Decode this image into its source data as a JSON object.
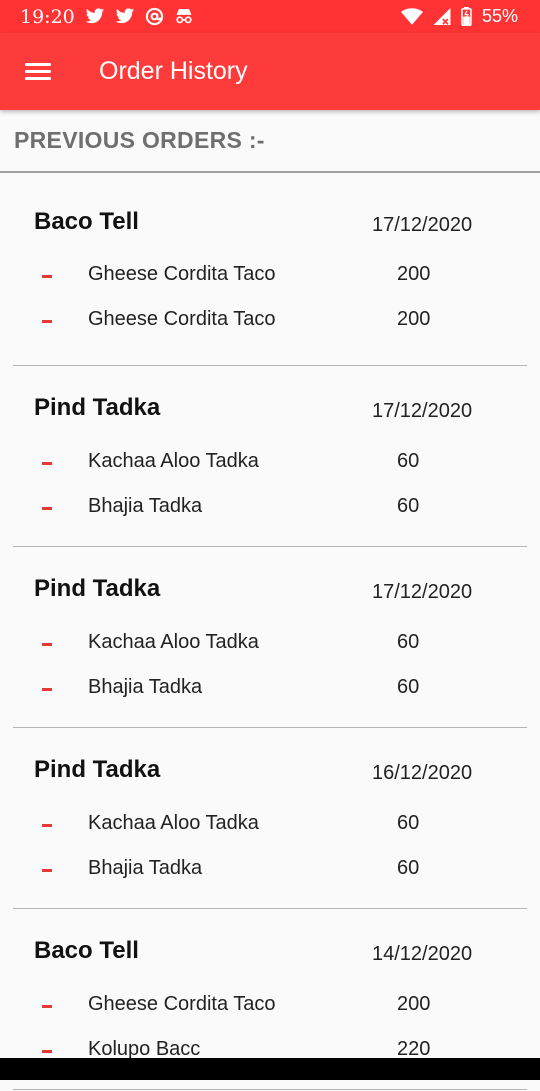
{
  "status_bar": {
    "time": "19:20",
    "battery": "55%"
  },
  "app_bar": {
    "title": "Order History"
  },
  "section": {
    "title": "PREVIOUS ORDERS :-"
  },
  "orders": [
    {
      "restaurant": "Baco Tell",
      "date": "17/12/2020",
      "items": [
        {
          "name": "Gheese Cordita Taco",
          "price": "200"
        },
        {
          "name": "Gheese Cordita Taco",
          "price": "200"
        }
      ]
    },
    {
      "restaurant": "Pind Tadka",
      "date": "17/12/2020",
      "items": [
        {
          "name": "Kachaa Aloo Tadka",
          "price": "60"
        },
        {
          "name": "Bhajia Tadka",
          "price": "60"
        }
      ]
    },
    {
      "restaurant": "Pind Tadka",
      "date": "17/12/2020",
      "items": [
        {
          "name": "Kachaa Aloo Tadka",
          "price": "60"
        },
        {
          "name": "Bhajia Tadka",
          "price": "60"
        }
      ]
    },
    {
      "restaurant": "Pind Tadka",
      "date": "16/12/2020",
      "items": [
        {
          "name": "Kachaa Aloo Tadka",
          "price": "60"
        },
        {
          "name": "Bhajia Tadka",
          "price": "60"
        }
      ]
    },
    {
      "restaurant": "Baco Tell",
      "date": "14/12/2020",
      "items": [
        {
          "name": "Gheese Cordita Taco",
          "price": "200"
        },
        {
          "name": "Kolupo Bacc",
          "price": "220"
        }
      ]
    }
  ],
  "colors": {
    "app_bar": "#fe3b3b",
    "status_bar": "#ff3333",
    "accent_dash": "#e53935"
  },
  "icons": {
    "status_left": [
      "twitter-icon",
      "twitter-icon",
      "at-sign-icon",
      "incognito-icon"
    ],
    "status_right": [
      "wifi-icon",
      "signal-icon",
      "battery-icon"
    ],
    "menu": "hamburger-menu-icon"
  }
}
